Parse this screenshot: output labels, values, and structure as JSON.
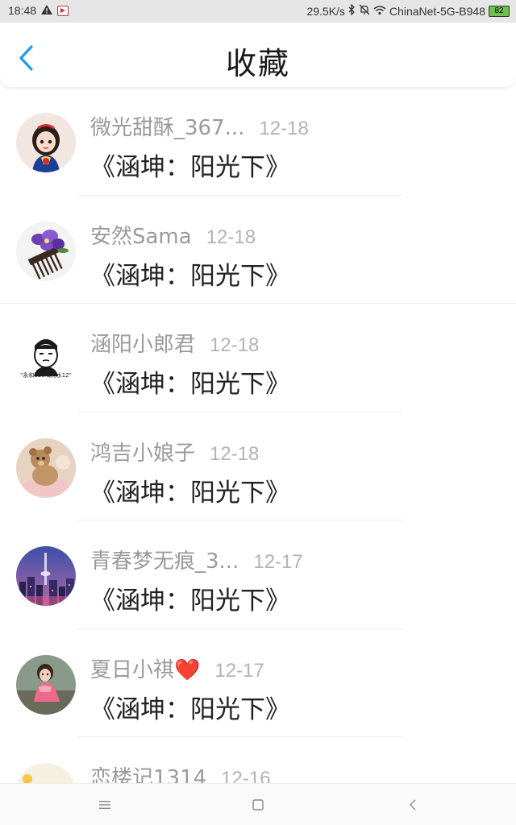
{
  "status_bar": {
    "time": "18:48",
    "speed": "29.5K/s",
    "network": "ChinaNet-5G-B948",
    "battery": "82"
  },
  "header": {
    "title": "收藏",
    "back_icon": "chevron-left-icon"
  },
  "favorites": [
    {
      "username": "微光甜酥_367...",
      "date": "12-18",
      "content": "《涵坤：阳光下》",
      "avatar": "snow-white"
    },
    {
      "username": "安然Sama",
      "date": "12-18",
      "content": "《涵坤：阳光下》",
      "avatar": "purple-flower-hairpin"
    },
    {
      "username": "涵阳小郎君",
      "date": "12-18",
      "content": "《涵坤：阳光下》",
      "avatar": "cartoon-man",
      "avatar_caption": "\"永和120喝死水12\""
    },
    {
      "username": "鸿吉小娘子",
      "date": "12-18",
      "content": "《涵坤：阳光下》",
      "avatar": "teddy-bear"
    },
    {
      "username": "青春梦无痕_3...",
      "date": "12-17",
      "content": "《涵坤：阳光下》",
      "avatar": "city-night-tower"
    },
    {
      "username": "夏日小祺❤️",
      "date": "12-17",
      "content": "《涵坤：阳光下》",
      "avatar": "girl-pink-dress"
    },
    {
      "username": "恋楼记1314",
      "date": "12-16",
      "content": "",
      "avatar": "yellow-partial"
    }
  ],
  "colors": {
    "accent": "#1e9be9",
    "title": "#1a1a1a",
    "username": "#9a9a9a",
    "date": "#b3b3b3",
    "content": "#222222",
    "status_bar_bg": "#e6e6e6"
  },
  "nav": {
    "menu_icon": "menu-icon",
    "home_icon": "home-square-icon",
    "back_icon": "back-triangle-icon"
  }
}
